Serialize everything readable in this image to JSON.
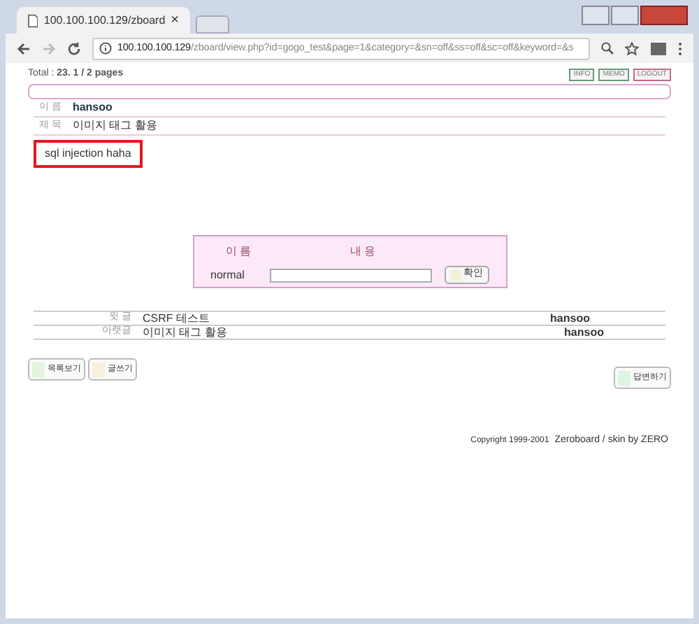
{
  "browser": {
    "tab_title": "100.100.100.129/zboard",
    "tab_close": "×",
    "url_host": "100.100.100.129",
    "url_path": "/zboard/view.php?id=gogo_test&page=1&category=&sn=off&ss=off&sc=off&keyword=&s"
  },
  "board": {
    "total": "Total : ",
    "total_value": "23. 1 / 2 pages",
    "top_buttons": [
      "INFO",
      "MEMO",
      "LOGOUT"
    ],
    "fields": [
      {
        "label": "이 름",
        "value": "hansoo",
        "kind": "name"
      },
      {
        "label": "제 목",
        "value": "이미지 태그 활용",
        "kind": "subject"
      }
    ],
    "content": "sql injection haha",
    "comment_form": {
      "name_header": "이 름",
      "content_header": "내 용",
      "name": "normal",
      "submit": "확인"
    },
    "nav": [
      {
        "label": "윗 글",
        "title": "CSRF 테스트",
        "author": "hansoo"
      },
      {
        "label": "아랫글",
        "title": "이미지 태그 활용",
        "author": "hansoo"
      }
    ],
    "buttons": [
      "목록보기",
      "글쓰기"
    ],
    "reply_button": "답변하기",
    "footer": "Copyright 1999-2001",
    "footer_link": "Zeroboard / skin by ZERO"
  }
}
